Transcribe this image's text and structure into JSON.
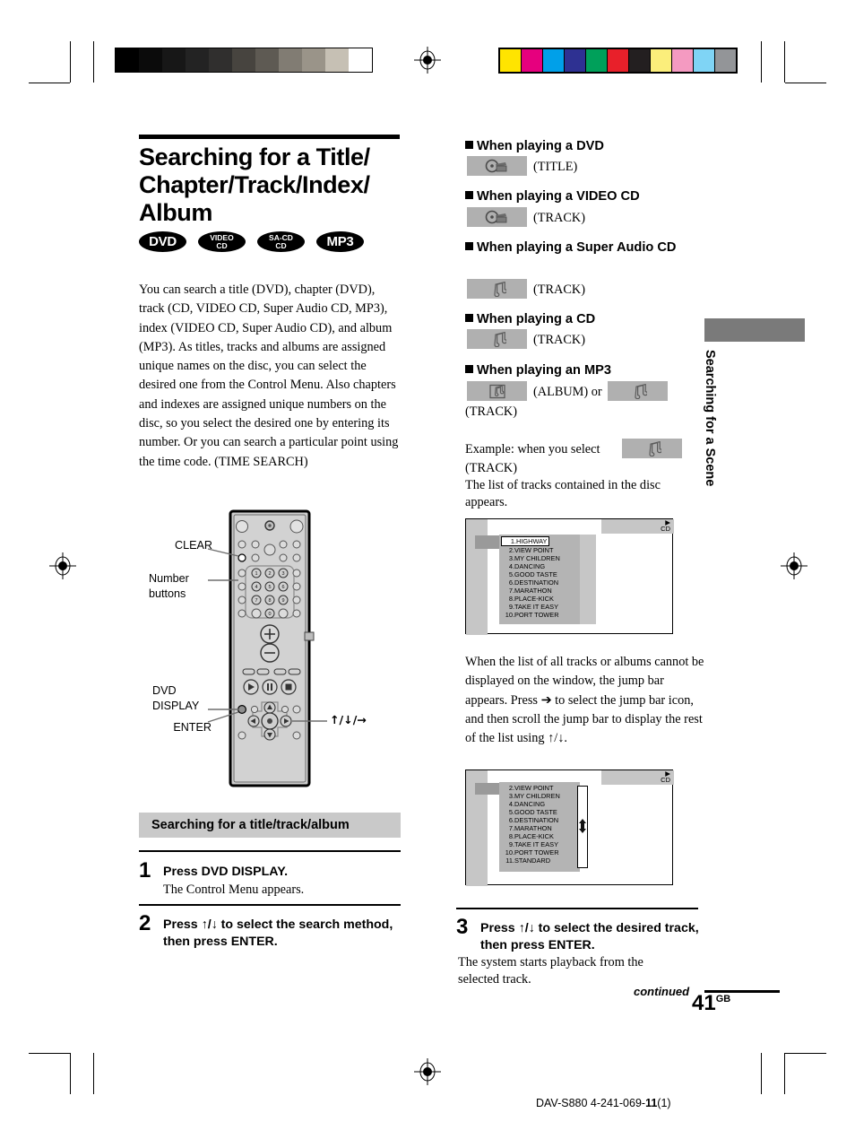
{
  "document": {
    "title": "Searching for a Title/Chapter/Track/Index/Album",
    "title_lines": [
      "Searching for a Title/",
      "Chapter/Track/Index/",
      "Album"
    ],
    "page_number": "41",
    "page_region": "GB",
    "continued_label": "continued",
    "footer_code_prefix": "DAV-S880 4-241-069-",
    "footer_code_bold": "11",
    "footer_code_suffix": "(1)",
    "side_tab_label": "Searching for a Scene"
  },
  "badges": [
    {
      "id": "dvd",
      "line1": "DVD",
      "line2": ""
    },
    {
      "id": "vcd",
      "line1": "VIDEO",
      "line2": "CD"
    },
    {
      "id": "sacd",
      "line1": "SA-CD",
      "line2": "CD"
    },
    {
      "id": "mp3",
      "line1": "MP3",
      "line2": ""
    }
  ],
  "intro": {
    "paragraph": "You can search a title (DVD), chapter (DVD), track (CD, VIDEO CD, Super Audio CD, MP3), index (VIDEO CD, Super Audio CD), and album (MP3). As titles, tracks and albums are assigned unique names on the disc, you can select the desired one from the Control Menu. Also chapters and indexes are assigned unique numbers on the disc, so you select the desired one by entering its number. Or you can search a particular point using the time code. (TIME SEARCH)"
  },
  "remote": {
    "labels": {
      "clear": "CLEAR",
      "number_buttons_l1": "Number",
      "number_buttons_l2": "buttons",
      "dvd_display_l1": "DVD",
      "dvd_display_l2": "DISPLAY",
      "enter": "ENTER",
      "arrows": "↑/↓/→"
    },
    "number_keys": [
      "1",
      "2",
      "3",
      "4",
      "5",
      "6",
      "7",
      "8",
      "9",
      "0"
    ]
  },
  "section": {
    "band_title": "Searching for a title/track/album",
    "steps": [
      {
        "number": "1",
        "bold_lines": [
          "Press DVD DISPLAY."
        ],
        "body_lines": [
          "The Control Menu appears."
        ]
      },
      {
        "number": "2",
        "bold_lines": [
          "Press ↑/↓ to select the search method,",
          "then press ENTER."
        ],
        "body_lines": []
      },
      {
        "number": "3",
        "bold_lines": [
          "Press ↑/↓ to select the desired track,",
          "then press ENTER."
        ],
        "body_lines": [
          "The system starts playback from the",
          "selected track."
        ]
      }
    ]
  },
  "right_column": {
    "cases": [
      {
        "heading": "When playing a DVD",
        "icon": "disc-clapper-icon",
        "label": "(TITLE)"
      },
      {
        "heading": "When playing a VIDEO CD",
        "icon": "disc-clapper-icon",
        "label": "(TRACK)"
      },
      {
        "heading": "When playing a Super Audio CD",
        "icon": "music-note-icon",
        "label": "(TRACK)"
      },
      {
        "heading": "When playing a CD",
        "icon": "music-note-icon",
        "label": "(TRACK)"
      }
    ],
    "mp3_case": {
      "heading": "When playing an MP3",
      "album_icon": "framed-music-note-icon",
      "album_label": "(ALBUM) or",
      "track_icon": "music-note-icon",
      "track_label": "(TRACK)"
    },
    "example": {
      "intro": "Example: when you select",
      "icon": "music-note-icon",
      "icon_label": "(TRACK)",
      "lines": [
        "The list of tracks contained in the disc",
        "appears."
      ]
    },
    "jumpbar_note": "When the list of all tracks or albums cannot be displayed on the window, the jump bar appears. Press ➔ to select the jump bar icon, and then scroll the jump bar to display the rest of the list using ↑/↓."
  },
  "screens": [
    {
      "id": "track-list-screen-1",
      "disc_label": "CD",
      "play_icon": "play-triangle-icon",
      "has_jumpbar": false,
      "tracks": [
        {
          "num": "1.",
          "name": "HIGHWAY",
          "highlighted": true
        },
        {
          "num": "2.",
          "name": "VIEW POINT",
          "highlighted": false
        },
        {
          "num": "3.",
          "name": "MY CHILDREN",
          "highlighted": false
        },
        {
          "num": "4.",
          "name": "DANCING",
          "highlighted": false
        },
        {
          "num": "5.",
          "name": "GOOD TASTE",
          "highlighted": false
        },
        {
          "num": "6.",
          "name": "DESTINATION",
          "highlighted": false
        },
        {
          "num": "7.",
          "name": "MARATHON",
          "highlighted": false
        },
        {
          "num": "8.",
          "name": "PLACE-KICK",
          "highlighted": false
        },
        {
          "num": "9.",
          "name": "TAKE IT EASY",
          "highlighted": false
        },
        {
          "num": "10.",
          "name": "PORT TOWER",
          "highlighted": false
        }
      ]
    },
    {
      "id": "track-list-screen-2",
      "disc_label": "CD",
      "play_icon": "play-triangle-icon",
      "has_jumpbar": true,
      "tracks": [
        {
          "num": "2.",
          "name": "VIEW POINT",
          "highlighted": false
        },
        {
          "num": "3.",
          "name": "MY CHILDREN",
          "highlighted": false
        },
        {
          "num": "4.",
          "name": "DANCING",
          "highlighted": false
        },
        {
          "num": "5.",
          "name": "GOOD TASTE",
          "highlighted": false
        },
        {
          "num": "6.",
          "name": "DESTINATION",
          "highlighted": false
        },
        {
          "num": "7.",
          "name": "MARATHON",
          "highlighted": false
        },
        {
          "num": "8.",
          "name": "PLACE-KICK",
          "highlighted": false
        },
        {
          "num": "9.",
          "name": "TAKE IT EASY",
          "highlighted": false
        },
        {
          "num": "10.",
          "name": "PORT TOWER",
          "highlighted": false
        },
        {
          "num": "11.",
          "name": "STANDARD",
          "highlighted": false
        }
      ]
    }
  ],
  "print_marks": {
    "grey_steps": [
      "#000000",
      "#0b0b0b",
      "#171717",
      "#232323",
      "#302f2e",
      "#47443f",
      "#5e5a53",
      "#817c73",
      "#9a9489",
      "#c6c0b4",
      "#ffffff"
    ],
    "color_swatches": [
      "#ffe400",
      "#e6007e",
      "#00a0e9",
      "#2e3192",
      "#00a05a",
      "#e8202a",
      "#231f20",
      "#fbee7b",
      "#f49ac1",
      "#7fd4f5",
      "#939598"
    ]
  },
  "colors": {
    "band_grey": "#c9c9c9",
    "icon_box_grey": "#b0b0b0",
    "tab_grey": "#7a7a7a",
    "screen_list_grey": "#b4b4b4",
    "screen_band_grey": "#c6c6c6"
  }
}
